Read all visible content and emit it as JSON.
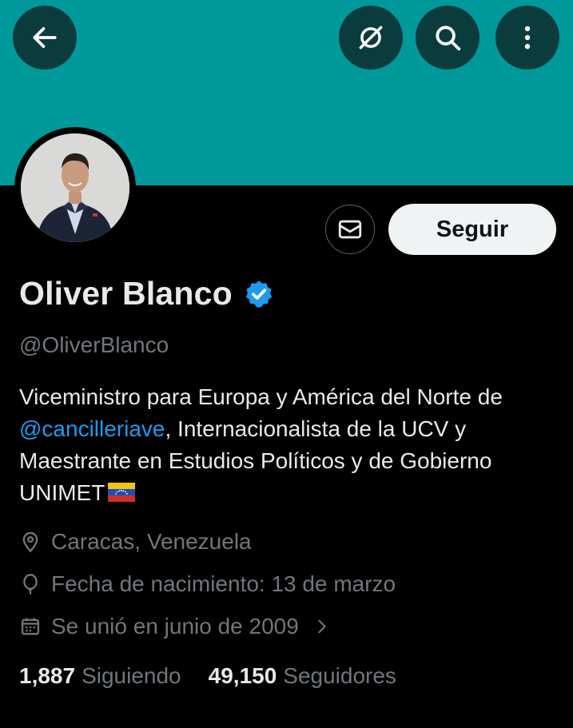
{
  "header": {
    "back_icon": "arrow-left-icon",
    "translate_icon": "no-translate-icon",
    "search_icon": "search-icon",
    "more_icon": "more-vertical-icon",
    "banner_color": "#00999b"
  },
  "profile": {
    "name": "Oliver Blanco",
    "verified": true,
    "handle": "@OliverBlanco",
    "bio_part1": "Viceministro para Europa y América del Norte de ",
    "bio_mention": "@cancilleriave",
    "bio_part2": ", Internacionalista de la UCV y Maestrante en Estudios Políticos y de Gobierno UNIMET",
    "location": "Caracas, Venezuela",
    "birthday": "Fecha de nacimiento: 13 de marzo",
    "joined": "Se unió en junio de 2009"
  },
  "actions": {
    "message_icon": "envelope-icon",
    "follow_label": "Seguir"
  },
  "stats": {
    "following_count": "1,887",
    "following_label": "Siguiendo",
    "followers_count": "49,150",
    "followers_label": "Seguidores"
  },
  "colors": {
    "accent": "#1d9bf0",
    "muted": "#71767b"
  }
}
